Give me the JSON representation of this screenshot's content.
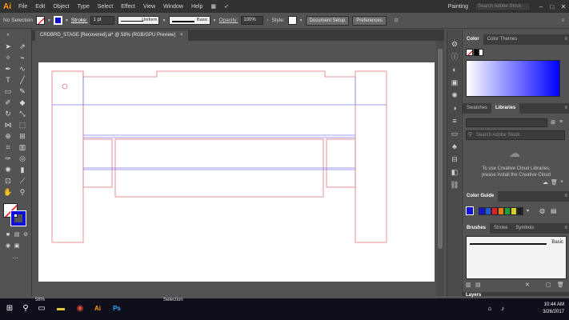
{
  "menubar": {
    "logo": "Ai",
    "items": [
      "File",
      "Edit",
      "Object",
      "Type",
      "Select",
      "Effect",
      "View",
      "Window",
      "Help"
    ],
    "workspace": "Painting",
    "search_placeholder": "Search Adobe Stock"
  },
  "controlbar": {
    "selection": "No Selection",
    "stroke_label": "Stroke:",
    "stroke_value": "1 pt",
    "profile": "Uniform",
    "brush": "Basic",
    "opacity_label": "Opacity:",
    "opacity_value": "100%",
    "style_label": "Style:",
    "doc_setup": "Document Setup",
    "preferences": "Preferences"
  },
  "document": {
    "tab_title": "CRDBRD_STAGE [Recovered].ai* @ 58% (RGB/GPU Preview)",
    "close": "×"
  },
  "panels": {
    "color_tabs": [
      "Color",
      "Color Themes"
    ],
    "libs_tabs": [
      "Swatches",
      "Libraries"
    ],
    "libs_search": "Search Adobe Stock",
    "cc_message_1": "To use Creative Cloud Libraries,",
    "cc_message_2": "please install the Creative Cloud",
    "color_guide_tab": "Color Guide",
    "brush_tabs": [
      "Brushes",
      "Stroke",
      "Symbols"
    ],
    "brush_name": "Basic",
    "layers_tab": "Layers"
  },
  "status": {
    "zoom": "58%",
    "tool": "Selection"
  },
  "taskbar": {
    "time": "10:44 AM",
    "date": "3/26/2017"
  },
  "colors": {
    "guide_red": "#e5737d",
    "guide_blue": "#7d7de8",
    "accent": "#ff9a00"
  }
}
